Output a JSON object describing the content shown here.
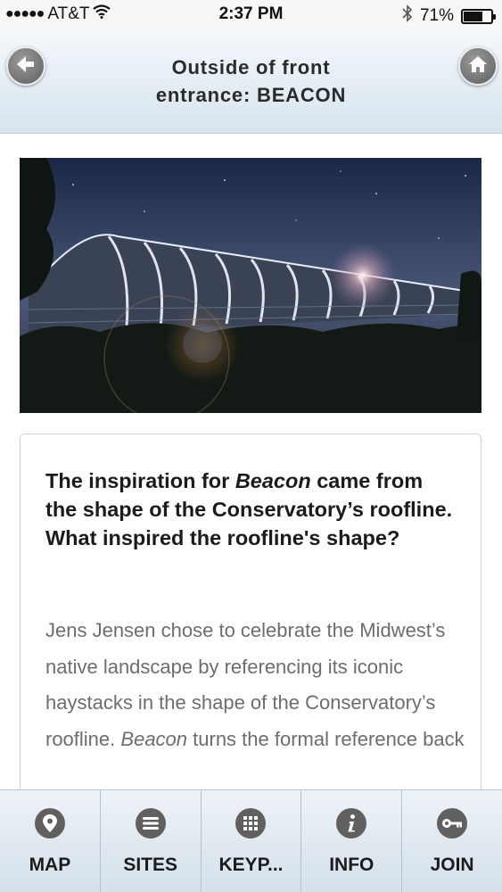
{
  "status_bar": {
    "carrier": "AT&T",
    "time": "2:37 PM",
    "battery": "71%",
    "battery_level": 0.71,
    "signal_dots": "●●●●●"
  },
  "header": {
    "title_line1": "Outside of front",
    "title_line2": "entrance: BEACON",
    "back_icon": "arrow-left-icon",
    "home_icon": "home-icon"
  },
  "content": {
    "question_part1": "The inspiration for ",
    "question_italic": "Beacon",
    "question_part2": " came from the shape of the Conservatory’s roofline. What inspired the roofline's shape?",
    "answer_main": "Jens Jensen chose to celebrate the Midwest’s native landscape by referencing its iconic haystacks in the shape of the Conservatory’s roofline.",
    "answer_italic": "Beacon",
    "answer_tail": " turns the formal reference back"
  },
  "tabs": [
    {
      "label": "MAP",
      "icon": "location-pin-icon"
    },
    {
      "label": "SITES",
      "icon": "list-icon"
    },
    {
      "label": "KEYP...",
      "icon": "keypad-icon"
    },
    {
      "label": "INFO",
      "icon": "info-icon"
    },
    {
      "label": "JOIN",
      "icon": "key-icon"
    }
  ]
}
